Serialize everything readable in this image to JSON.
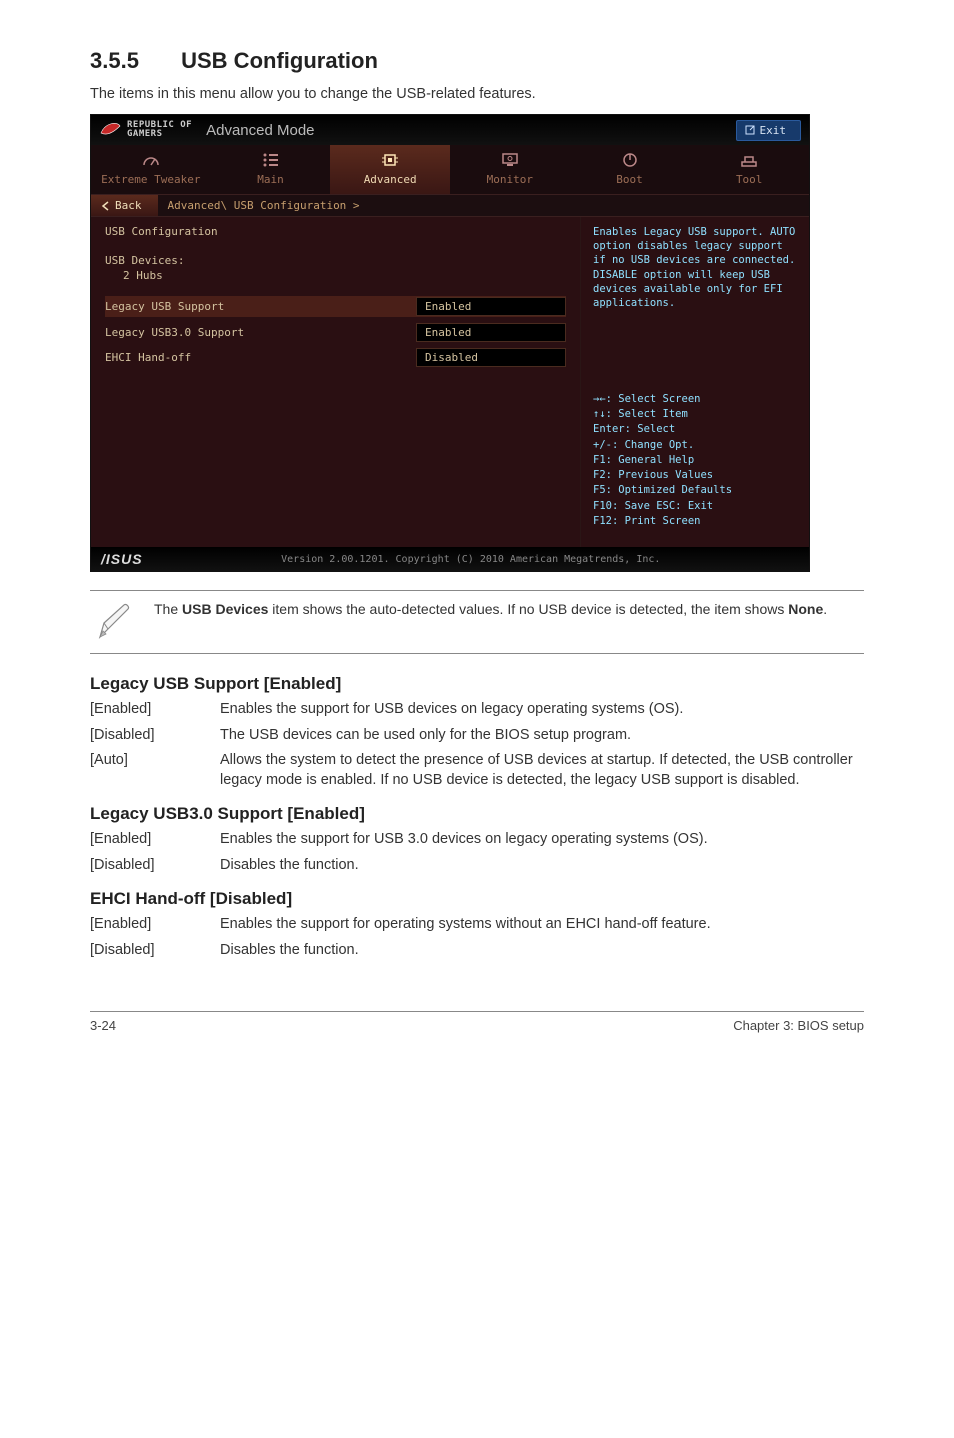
{
  "section": {
    "number": "3.5.5",
    "title": "USB Configuration"
  },
  "intro": "The items in this menu allow you to change the USB-related features.",
  "bios": {
    "brand_top": "REPUBLIC OF",
    "brand_bottom": "GAMERS",
    "mode": "Advanced Mode",
    "exit": "Exit",
    "tabs": [
      {
        "id": "extreme-tweaker",
        "label": "Extreme Tweaker"
      },
      {
        "id": "main",
        "label": "Main"
      },
      {
        "id": "advanced",
        "label": "Advanced"
      },
      {
        "id": "monitor",
        "label": "Monitor"
      },
      {
        "id": "boot",
        "label": "Boot"
      },
      {
        "id": "tool",
        "label": "Tool"
      }
    ],
    "back": "Back",
    "breadcrumb": "Advanced\\ USB Configuration >",
    "panel_title": "USB Configuration",
    "usb_devices_label": "USB Devices:",
    "usb_devices_value": "2 Hubs",
    "options": [
      {
        "label": "Legacy USB Support",
        "value": "Enabled",
        "highlight": true
      },
      {
        "label": "Legacy USB3.0 Support",
        "value": "Enabled",
        "highlight": false
      },
      {
        "label": "EHCI Hand-off",
        "value": "Disabled",
        "highlight": false
      }
    ],
    "help": "Enables Legacy USB support. AUTO option disables legacy support if no USB devices are connected. DISABLE option will keep USB devices available only for EFI applications.",
    "keys": [
      "→←: Select Screen",
      "↑↓: Select Item",
      "Enter: Select",
      "+/-: Change Opt.",
      "F1: General Help",
      "F2: Previous Values",
      "F5: Optimized Defaults",
      "F10: Save  ESC: Exit",
      "F12: Print Screen"
    ],
    "footer_brand": "/ISUS",
    "footer_text": "Version 2.00.1201. Copyright (C) 2010 American Megatrends, Inc."
  },
  "note": {
    "text_a": "The ",
    "text_bold1": "USB Devices",
    "text_b": " item shows the auto-detected values. If no USB device is detected, the item shows ",
    "text_bold2": "None",
    "text_c": "."
  },
  "settings": [
    {
      "title": "Legacy USB Support [Enabled]",
      "defs": [
        {
          "k": "[Enabled]",
          "v": "Enables the support for USB devices on legacy operating systems (OS)."
        },
        {
          "k": "[Disabled]",
          "v": "The USB devices can be used only for the BIOS setup program."
        },
        {
          "k": "[Auto]",
          "v": "Allows the system to detect the presence of USB devices at startup. If detected, the USB controller legacy mode is enabled. If no USB device is detected, the legacy USB support is disabled."
        }
      ]
    },
    {
      "title": "Legacy USB3.0 Support [Enabled]",
      "defs": [
        {
          "k": "[Enabled]",
          "v": "Enables the support for USB 3.0 devices on legacy operating systems (OS)."
        },
        {
          "k": "[Disabled]",
          "v": "Disables the function."
        }
      ]
    },
    {
      "title": "EHCI Hand-off [Disabled]",
      "defs": [
        {
          "k": "[Enabled]",
          "v": "Enables the support for operating systems without an EHCI hand-off feature."
        },
        {
          "k": "[Disabled]",
          "v": "Disables the function."
        }
      ]
    }
  ],
  "footer": {
    "left": "3-24",
    "right": "Chapter 3: BIOS setup"
  }
}
